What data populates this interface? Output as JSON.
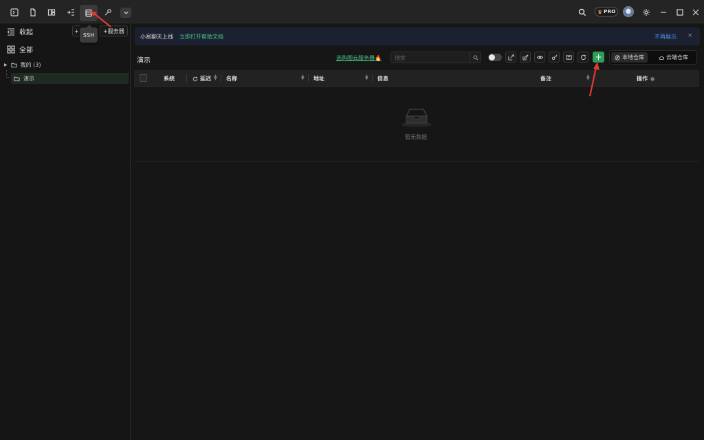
{
  "titlebar": {
    "tooltip": "SSH",
    "pro_badge": "PRO",
    "icons": [
      "terminal-icon",
      "file-icon",
      "apps-icon",
      "sftp-icon",
      "server-list-icon",
      "tool-icon",
      "chevron-down-icon"
    ]
  },
  "sidebar": {
    "collapse_label": "收起",
    "all_label": "全部",
    "add_small": "+",
    "add_server_label": "+服务器",
    "tree": [
      {
        "label": "我的 (3)"
      },
      {
        "label": "演示"
      }
    ]
  },
  "banner": {
    "text": "小易聊天上线",
    "link": "立即打开帮助文档",
    "dismiss": "不再展示",
    "close": "×"
  },
  "toolbar": {
    "title": "演示",
    "promo": "选购图云服务器🔥",
    "search_placeholder": "搜索",
    "add_label": "+",
    "local_repo": "本地仓库",
    "cloud_repo": "云端仓库"
  },
  "table": {
    "columns": {
      "system": "系统",
      "latency": "延迟",
      "name": "名称",
      "address": "地址",
      "info": "信息",
      "remark": "备注",
      "actions": "操作"
    },
    "empty_text": "暂无数据"
  },
  "colors": {
    "accent_green": "#2e9e5b",
    "link_green": "#4cc38a",
    "link_blue": "#4d8fe8",
    "annotation_red": "#e53935"
  }
}
